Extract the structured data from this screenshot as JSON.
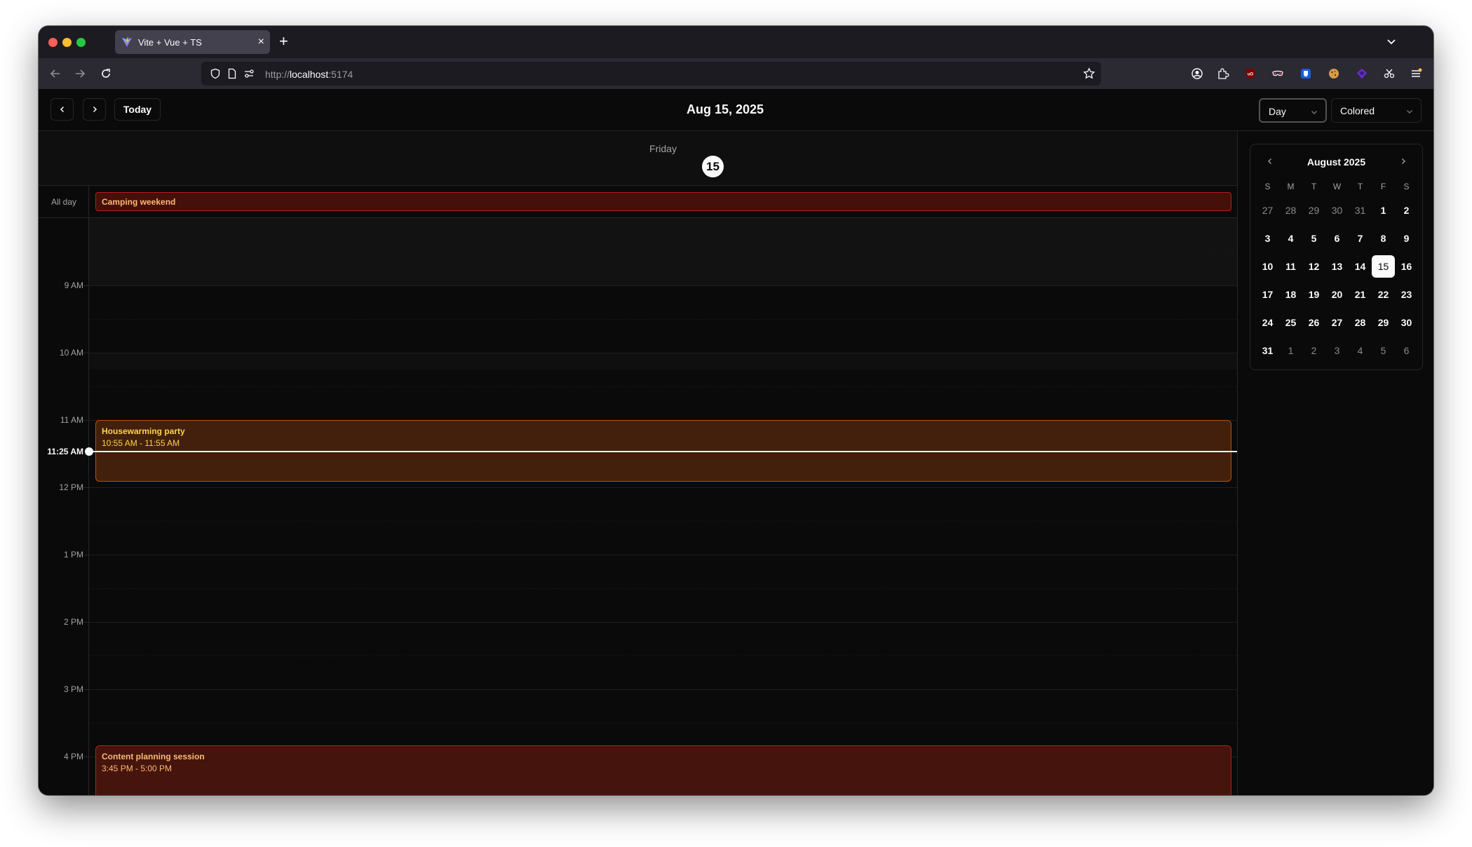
{
  "browser": {
    "tab_title": "Vite + Vue + TS",
    "url_scheme": "http://",
    "url_host": "localhost",
    "url_port": ":5174"
  },
  "header": {
    "today_label": "Today",
    "title": "Aug 15, 2025",
    "view_select": "Day",
    "color_select": "Colored"
  },
  "day": {
    "weekday": "Friday",
    "date_number": "15",
    "all_day_label": "All day",
    "all_day_event": "Camping weekend"
  },
  "hours": [
    "9 AM",
    "10 AM",
    "11 AM",
    "12 PM",
    "1 PM",
    "2 PM",
    "3 PM",
    "4 PM"
  ],
  "now_label": "11:25 AM",
  "events": [
    {
      "title": "Housewarming party",
      "time": "10:55 AM - 11:55 AM",
      "color": "#43200b"
    },
    {
      "title": "Content planning session",
      "time": "3:45 PM - 5:00 PM",
      "color": "#45140c"
    }
  ],
  "mini_calendar": {
    "title": "August 2025",
    "weekdays": [
      "S",
      "M",
      "T",
      "W",
      "T",
      "F",
      "S"
    ],
    "weeks": [
      [
        "27",
        "28",
        "29",
        "30",
        "31",
        "1",
        "2"
      ],
      [
        "3",
        "4",
        "5",
        "6",
        "7",
        "8",
        "9"
      ],
      [
        "10",
        "11",
        "12",
        "13",
        "14",
        "15",
        "16"
      ],
      [
        "17",
        "18",
        "19",
        "20",
        "21",
        "22",
        "23"
      ],
      [
        "24",
        "25",
        "26",
        "27",
        "28",
        "29",
        "30"
      ],
      [
        "31",
        "1",
        "2",
        "3",
        "4",
        "5",
        "6"
      ]
    ],
    "selected": "15"
  },
  "colors": {
    "accent_orange": "#b45309",
    "accent_red": "#b91c1c"
  }
}
